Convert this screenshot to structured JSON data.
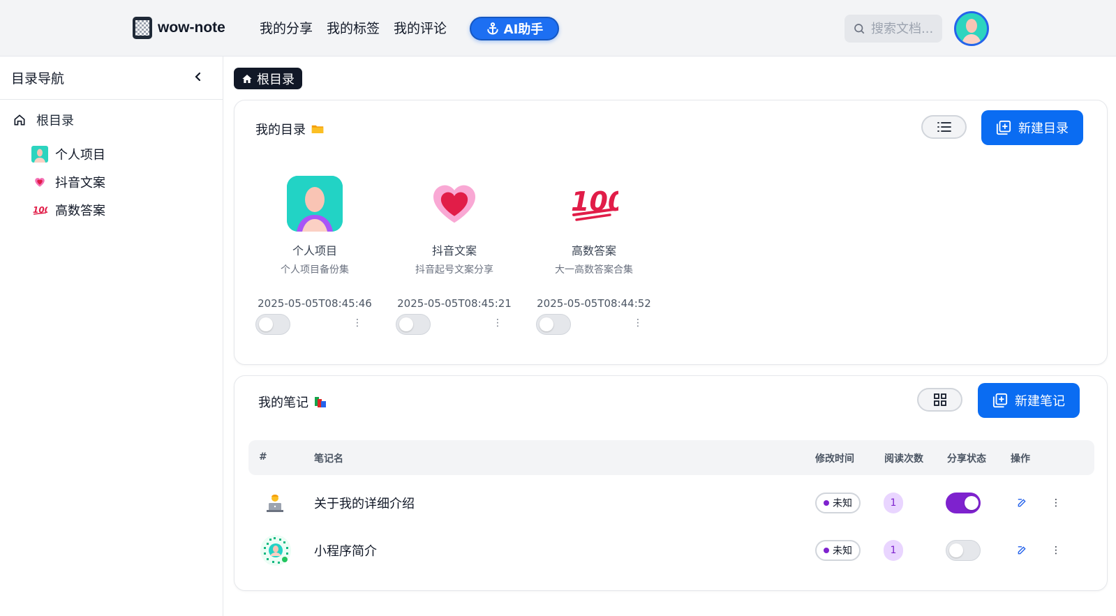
{
  "header": {
    "app_name": "wow-note",
    "nav": [
      "我的分享",
      "我的标签",
      "我的评论"
    ],
    "ai_button": "AI助手",
    "search_placeholder": "搜索文档..."
  },
  "sidebar": {
    "title": "目录导航",
    "root_label": "根目录",
    "items": [
      {
        "label": "个人项目",
        "icon": "avatar-icon"
      },
      {
        "label": "抖音文案",
        "icon": "heart-icon"
      },
      {
        "label": "高数答案",
        "icon": "hundred-icon"
      }
    ]
  },
  "breadcrumb": {
    "root": "根目录"
  },
  "directories": {
    "title": "我的目录",
    "new_button": "新建目录",
    "folders": [
      {
        "name": "个人项目",
        "desc": "个人项目备份集",
        "time": "2025-05-05T08:45:46",
        "shared": false
      },
      {
        "name": "抖音文案",
        "desc": "抖音起号文案分享",
        "time": "2025-05-05T08:45:21",
        "shared": false
      },
      {
        "name": "高数答案",
        "desc": "大一高数答案合集",
        "time": "2025-05-05T08:44:52",
        "shared": false
      }
    ]
  },
  "notes": {
    "title": "我的笔记",
    "new_button": "新建笔记",
    "columns": [
      "#",
      "笔记名",
      "修改时间",
      "阅读次数",
      "分享状态",
      "操作"
    ],
    "rows": [
      {
        "name": "关于我的详细介绍",
        "modified": "未知",
        "reads": "1",
        "shared": true
      },
      {
        "name": "小程序简介",
        "modified": "未知",
        "reads": "1",
        "shared": false
      }
    ]
  },
  "colors": {
    "primary": "#0a6cf2",
    "accent_purple": "#7e22ce",
    "dark": "#111827"
  }
}
